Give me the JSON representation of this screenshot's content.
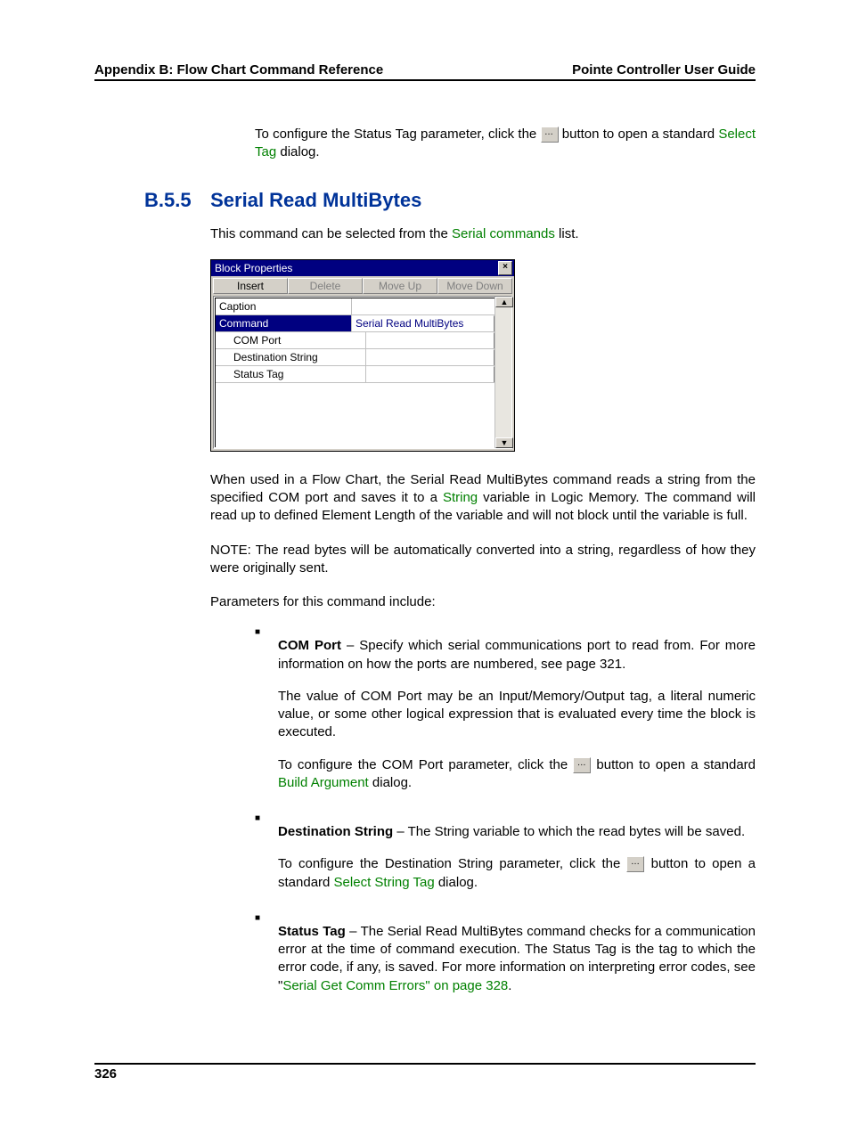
{
  "header": {
    "left": "Appendix B: Flow Chart Command Reference",
    "right": "Pointe Controller User Guide"
  },
  "intro": {
    "pre": "To configure the Status Tag parameter, click the ",
    "post": " button to open a standard ",
    "link": "Select Tag",
    "tail": " dialog."
  },
  "section": {
    "num": "B.5.5",
    "title": "Serial Read MultiBytes"
  },
  "lead": {
    "pre": "This command can be selected from the ",
    "link": "Serial commands",
    "post": " list."
  },
  "dialog": {
    "title": "Block Properties",
    "buttons": {
      "insert": "Insert",
      "delete": "Delete",
      "moveup": "Move Up",
      "movedown": "Move Down"
    },
    "rows": {
      "caption": "Caption",
      "command_label": "Command",
      "command_value": "Serial Read MultiBytes",
      "comport": "COM Port",
      "dest": "Destination String",
      "status": "Status Tag"
    }
  },
  "body1": {
    "pre": "When used in a Flow Chart, the Serial Read MultiBytes command reads a string from the specified COM port and saves it to a ",
    "link": "String",
    "post": " variable in Logic Memory. The command will read up to defined Element Length of the variable and will not block until the variable is full."
  },
  "note": "NOTE: The read bytes will be automatically converted into a string, regardless of how they were originally sent.",
  "paramlead": "Parameters for this command include:",
  "p1": {
    "head": "COM Port",
    "t1": " – Specify which serial communications port to read from. For more information on how the ports are numbered, see page 321.",
    "t2": "The value of COM Port may be an Input/Memory/Output tag, a literal numeric value, or some other logical expression that is evaluated every time the block is executed.",
    "t3a": "To configure the COM Port parameter, click the ",
    "t3b": " button to open a standard ",
    "t3link": "Build Argument",
    "t3c": " dialog."
  },
  "p2": {
    "head": "Destination String",
    "t1": " – The String variable to which the read bytes will be saved.",
    "t2a": "To configure the Destination String parameter, click the ",
    "t2b": " button to open a standard ",
    "t2link": "Select String Tag",
    "t2c": " dialog."
  },
  "p3": {
    "head": "Status Tag",
    "t1": " – The Serial Read MultiBytes command checks for a communication error at the time of command execution. The Status Tag is the tag to which the error code, if any, is saved. For more information on interpreting error codes, see \"",
    "link": "Serial Get Comm Errors\" on page 328",
    "tail": "."
  },
  "page_num": "326"
}
